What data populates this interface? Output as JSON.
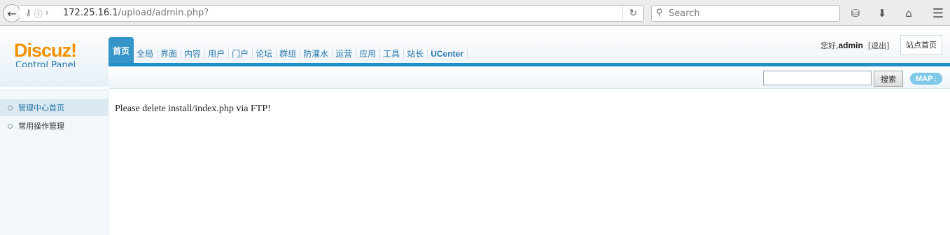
{
  "browser": {
    "url_host": "172.25.16.1",
    "url_path": "/upload/admin.php?",
    "search_placeholder": "Search"
  },
  "header": {
    "logo_brand": "Discuz!",
    "logo_sub": "Control Panel",
    "tabs": [
      {
        "label": "首页"
      },
      {
        "label": "全局"
      },
      {
        "label": "界面"
      },
      {
        "label": "内容"
      },
      {
        "label": "用户"
      },
      {
        "label": "门户"
      },
      {
        "label": "论坛"
      },
      {
        "label": "群组"
      },
      {
        "label": "防灌水"
      },
      {
        "label": "运营"
      },
      {
        "label": "应用"
      },
      {
        "label": "工具"
      },
      {
        "label": "站长"
      },
      {
        "label": "UCenter"
      }
    ],
    "greeting": "您好,",
    "username": "admin",
    "logout": "[退出]",
    "site_home": "站点首页"
  },
  "search": {
    "button": "搜索",
    "map": "MAP"
  },
  "sidebar": {
    "items": [
      {
        "label": "管理中心首页"
      },
      {
        "label": "常用操作管理"
      }
    ]
  },
  "main": {
    "message": "Please delete install/index.php via FTP!"
  }
}
